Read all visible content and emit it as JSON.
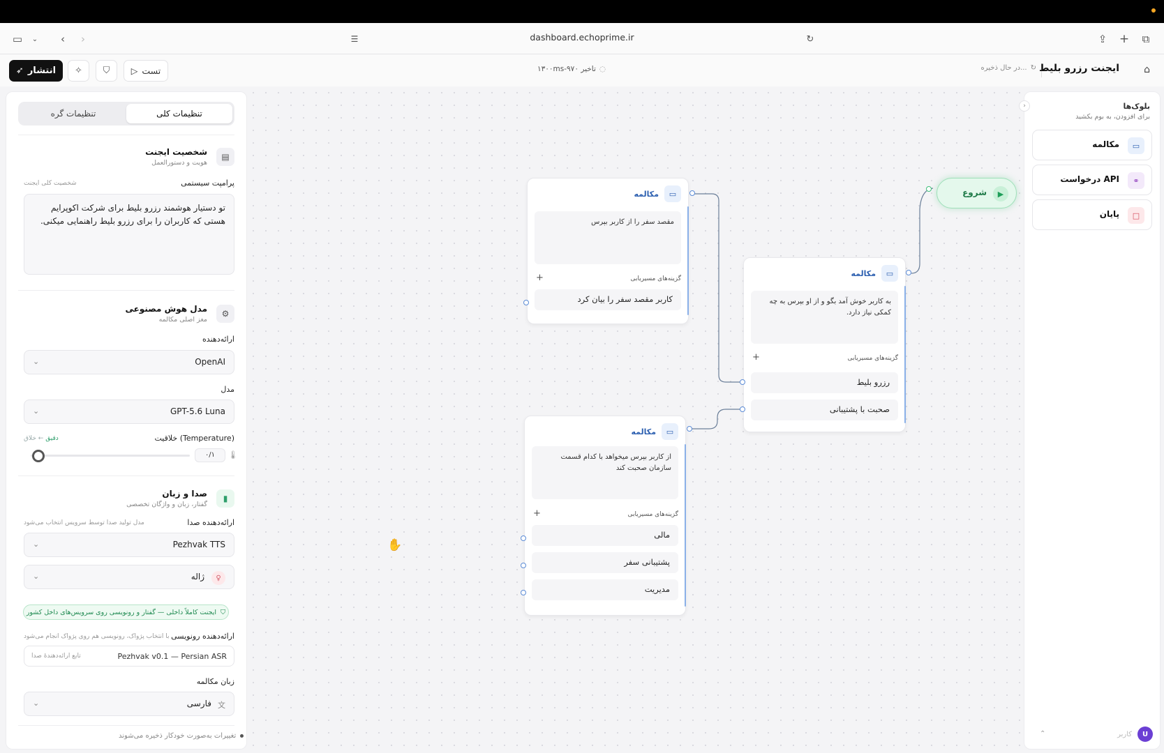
{
  "browser": {
    "url": "dashboard.echoprime.ir"
  },
  "header": {
    "publish_label": "انتشار",
    "test_label": "تست",
    "latency_text": "۱۳۰۰ms-۹۷۰ تاخیر",
    "saving_text": "در حال ذخیره...",
    "app_title": "ایجنت رزرو بلیط"
  },
  "left_panel": {
    "tabs": {
      "general": "تنظیمات کلی",
      "node": "تنظیمات گره"
    },
    "persona": {
      "title": "شخصیت ایجنت",
      "subtitle": "هویت و دستورالعمل",
      "prompt_label": "پرامپت سیستمی",
      "prompt_hint": "شخصیت کلی ایجنت",
      "prompt_text": "تو دستیار هوشمند رزرو بلیط برای شرکت اکوپرایم هستی که کاربران را برای رزرو بلیط راهنمایی میکنی."
    },
    "model": {
      "title": "مدل هوش مصنوعی",
      "subtitle": "مغز اصلی مکالمه",
      "provider_label": "ارائه‌دهنده",
      "provider_value": "OpenAI",
      "model_label": "مدل",
      "model_value": "GPT-5.6 Luna",
      "temperature_label": "خلاقیت (Temperature)",
      "temperature_range_low": "دقیق",
      "temperature_range_high": "خلاق",
      "temperature_arrow": "←",
      "temperature_value": "۰/۱",
      "temperature_fraction": 0.05
    },
    "voice": {
      "title": "صدا و زبان",
      "subtitle": "گفتار، زبان و واژگان تخصصی",
      "tts_label": "ارائه‌دهنده صدا",
      "tts_hint": "مدل تولید صدا توسط سرویس انتخاب می‌شود",
      "tts_value": "Pezhvak TTS",
      "voice_value": "ژاله",
      "badge_text": "ایجنت کاملاً داخلی — گفتار و رونویسی روی سرویس‌های داخل کشور",
      "asr_label": "ارائه‌دهنده رونویسی",
      "asr_hint": "با انتخاب پژواک، رونویسی هم روی پژواک انجام می‌شود",
      "asr_value": "Pezhvak v0.1 — Persian ASR",
      "asr_side": "تابع ارائه‌دهندهٔ صدا",
      "language_label": "زبان مکالمه",
      "language_value": "فارسی"
    },
    "footer_note": "تغییرات به‌صورت خودکار ذخیره می‌شوند"
  },
  "canvas": {
    "start_label": "شروع",
    "routes_label": "گزینه‌های مسیریابی",
    "nodes": [
      {
        "title": "مکالمه",
        "body": "به کاربر خوش آمد بگو و از او بپرس به چه کمکی نیاز دارد.",
        "routes": [
          "رزرو بلیط",
          "صحبت با پشتیبانی"
        ]
      },
      {
        "title": "مکالمه",
        "body": "مقصد سفر را از کاربر بپرس",
        "routes": [
          "کاربر مقصد سفر را بیان کرد"
        ]
      },
      {
        "title": "مکالمه",
        "body": "از کاربر بپرس میخواهد با کدام قسمت سازمان صحبت کند",
        "routes": [
          "مالی",
          "پشتیبانی سفر",
          "مدیریت"
        ]
      }
    ]
  },
  "right_panel": {
    "title": "بلوک‌ها",
    "subtitle": "برای افزودن، به بوم بکشید",
    "blocks": [
      {
        "label": "مکالمه",
        "color": "#2c5fb0"
      },
      {
        "label": "درخواست API",
        "color": "#9b4fc4"
      },
      {
        "label": "پایان",
        "color": "#d4485a"
      }
    ],
    "user_name": "کاربر",
    "user_initial": "U"
  },
  "colors": {
    "accent_blue": "#2c5fb0",
    "start_green": "#1f9e59",
    "edge": "#6b7f99"
  }
}
